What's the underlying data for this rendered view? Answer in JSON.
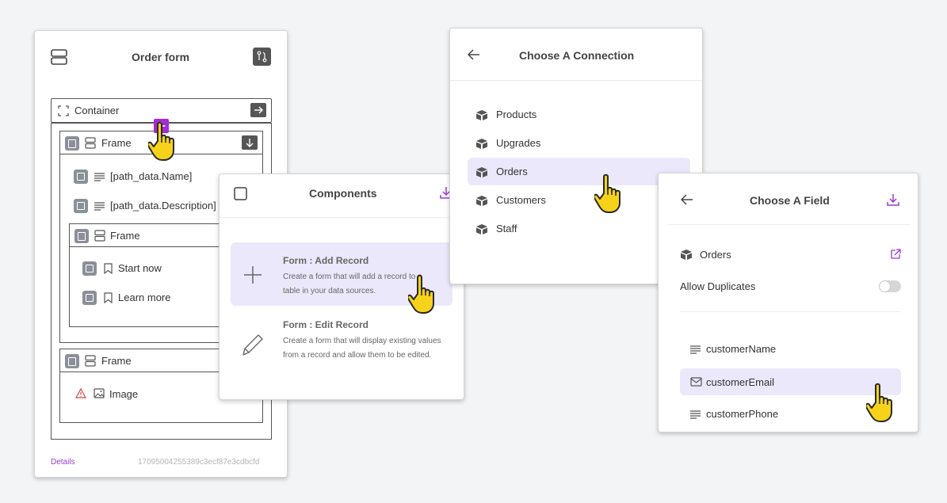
{
  "order_form": {
    "title": "Order form",
    "container_label": "Container",
    "frame_label": "Frame",
    "items": [
      "[path_data.Name]",
      "[path_data.Description]"
    ],
    "inner_frame_label": "Frame",
    "buttons": [
      "Start now",
      "Learn more"
    ],
    "bottom_frame_label": "Frame",
    "image_label": "Image",
    "footer_details": "Details",
    "footer_id": "17095004255389c3ecf87e3cdbcfd"
  },
  "components": {
    "title": "Components",
    "options": [
      {
        "title": "Form : Add Record",
        "description": "Create a form that will add a record to a table in your data sources."
      },
      {
        "title": "Form : Edit Record",
        "description": "Create a form that will display existing values from a record and allow them to be edited."
      }
    ]
  },
  "connection": {
    "title": "Choose A Connection",
    "items": [
      "Products",
      "Upgrades",
      "Orders",
      "Customers",
      "Staff"
    ],
    "selected": "Orders"
  },
  "field": {
    "title": "Choose A Field",
    "connection_name": "Orders",
    "allow_duplicates_label": "Allow Duplicates",
    "allow_duplicates": false,
    "fields": [
      "customerName",
      "customerEmail",
      "customerPhone"
    ],
    "selected": "customerEmail"
  },
  "colors": {
    "accent": "#9b3ad4",
    "highlight": "#ece8fb",
    "plus_badge": "#a42bd6",
    "hand": "#f7d21a"
  }
}
